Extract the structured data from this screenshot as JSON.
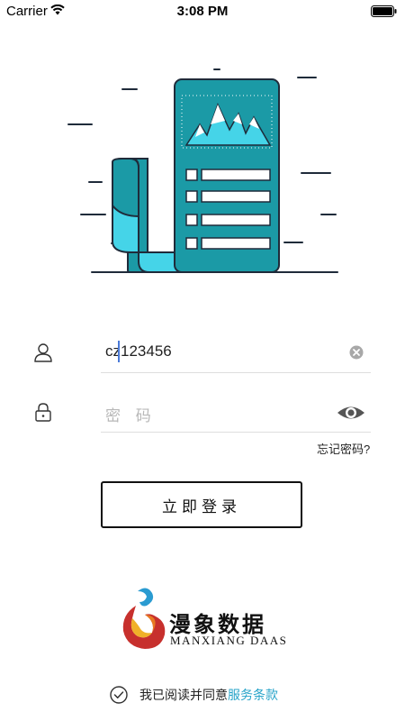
{
  "status_bar": {
    "carrier": "Carrier",
    "time": "3:08 PM"
  },
  "login": {
    "username_value": "cz123456",
    "password_placeholder": "密 码",
    "forgot_password": "忘记密码?",
    "submit_label": "立即登录"
  },
  "brand": {
    "name_cn": "漫象数据",
    "name_en": "MANXIANG DAAS"
  },
  "agreement": {
    "text": "我已阅读并同意",
    "link": "服务条款"
  },
  "colors": {
    "accent": "#28a4c9",
    "illustration_teal": "#1b9aa6",
    "illustration_cyan": "#45d4e8"
  }
}
